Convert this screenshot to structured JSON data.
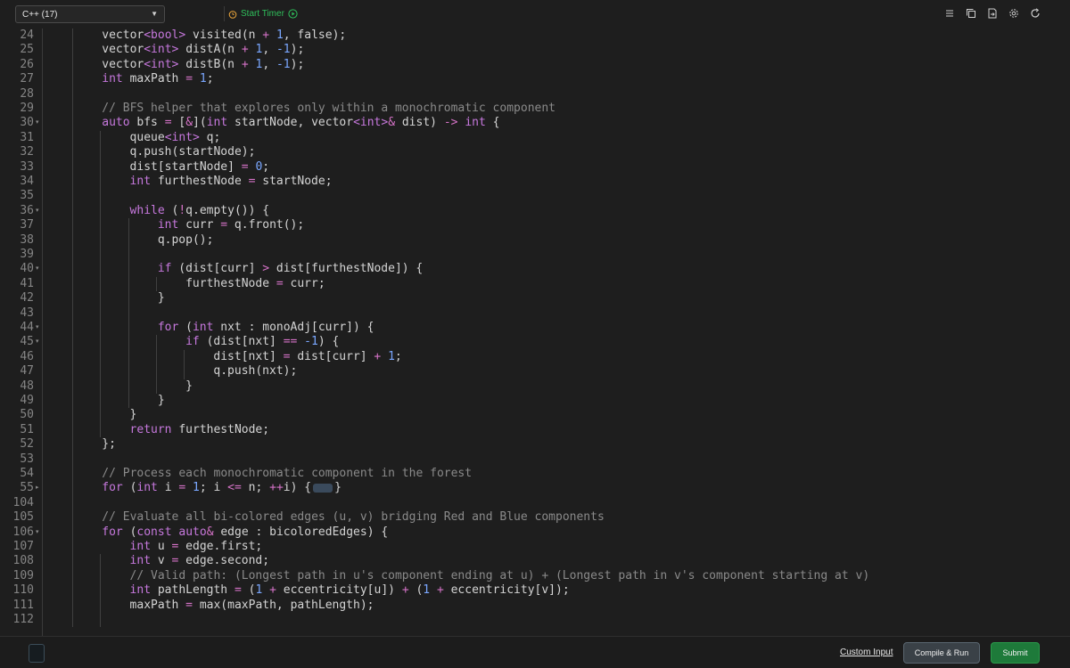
{
  "toolbar": {
    "language": "C++ (17)",
    "timer_label": "Start Timer"
  },
  "editor": {
    "lines": [
      {
        "n": "24",
        "fold": false,
        "indent": 1,
        "html": "vector<span class='ty'>&lt;bool&gt;</span> visited(n <span class='op'>+</span> <span class='num'>1</span>, false);"
      },
      {
        "n": "25",
        "fold": false,
        "indent": 1,
        "html": "vector<span class='ty'>&lt;int&gt;</span> distA(n <span class='op'>+</span> <span class='num'>1</span>, <span class='num'>-1</span>);"
      },
      {
        "n": "26",
        "fold": false,
        "indent": 1,
        "html": "vector<span class='ty'>&lt;int&gt;</span> distB(n <span class='op'>+</span> <span class='num'>1</span>, <span class='num'>-1</span>);"
      },
      {
        "n": "27",
        "fold": false,
        "indent": 1,
        "html": "<span class='kw'>int</span> maxPath <span class='op'>=</span> <span class='num'>1</span>;"
      },
      {
        "n": "28",
        "fold": false,
        "indent": 1,
        "html": ""
      },
      {
        "n": "29",
        "fold": false,
        "indent": 1,
        "html": "<span class='cm'>// BFS helper that explores only within a monochromatic component</span>"
      },
      {
        "n": "30",
        "fold": true,
        "indent": 1,
        "html": "<span class='kw'>auto</span> bfs <span class='op'>=</span> [<span class='op'>&amp;</span>](<span class='kw'>int</span> startNode, vector<span class='ty'>&lt;int&gt;</span><span class='op'>&amp;</span> dist) <span class='op'>-&gt;</span> <span class='kw'>int</span> {"
      },
      {
        "n": "31",
        "fold": false,
        "indent": 2,
        "html": "queue<span class='ty'>&lt;int&gt;</span> q;"
      },
      {
        "n": "32",
        "fold": false,
        "indent": 2,
        "html": "q.push(startNode);"
      },
      {
        "n": "33",
        "fold": false,
        "indent": 2,
        "html": "dist[startNode] <span class='op'>=</span> <span class='num'>0</span>;"
      },
      {
        "n": "34",
        "fold": false,
        "indent": 2,
        "html": "<span class='kw'>int</span> furthestNode <span class='op'>=</span> startNode;"
      },
      {
        "n": "35",
        "fold": false,
        "indent": 2,
        "html": ""
      },
      {
        "n": "36",
        "fold": true,
        "indent": 2,
        "html": "<span class='kw'>while</span> (<span class='op'>!</span>q.empty()) {"
      },
      {
        "n": "37",
        "fold": false,
        "indent": 3,
        "html": "<span class='kw'>int</span> curr <span class='op'>=</span> q.front();"
      },
      {
        "n": "38",
        "fold": false,
        "indent": 3,
        "html": "q.pop();"
      },
      {
        "n": "39",
        "fold": false,
        "indent": 3,
        "html": ""
      },
      {
        "n": "40",
        "fold": true,
        "indent": 3,
        "html": "<span class='kw'>if</span> (dist[curr] <span class='op'>&gt;</span> dist[furthestNode]) {"
      },
      {
        "n": "41",
        "fold": false,
        "indent": 4,
        "html": "furthestNode <span class='op'>=</span> curr;"
      },
      {
        "n": "42",
        "fold": false,
        "indent": 3,
        "html": "}"
      },
      {
        "n": "43",
        "fold": false,
        "indent": 3,
        "html": ""
      },
      {
        "n": "44",
        "fold": true,
        "indent": 3,
        "html": "<span class='kw'>for</span> (<span class='kw'>int</span> nxt : monoAdj[curr]) {"
      },
      {
        "n": "45",
        "fold": true,
        "indent": 4,
        "html": "<span class='kw'>if</span> (dist[nxt] <span class='op'>==</span> <span class='num'>-1</span>) {"
      },
      {
        "n": "46",
        "fold": false,
        "indent": 5,
        "html": "dist[nxt] <span class='op'>=</span> dist[curr] <span class='op'>+</span> <span class='num'>1</span>;"
      },
      {
        "n": "47",
        "fold": false,
        "indent": 5,
        "html": "q.push(nxt);"
      },
      {
        "n": "48",
        "fold": false,
        "indent": 4,
        "html": "}"
      },
      {
        "n": "49",
        "fold": false,
        "indent": 3,
        "html": "}"
      },
      {
        "n": "50",
        "fold": false,
        "indent": 2,
        "html": "}"
      },
      {
        "n": "51",
        "fold": false,
        "indent": 2,
        "html": "<span class='kw'>return</span> furthestNode;"
      },
      {
        "n": "52",
        "fold": false,
        "indent": 1,
        "html": "};"
      },
      {
        "n": "53",
        "fold": false,
        "indent": 1,
        "html": ""
      },
      {
        "n": "54",
        "fold": false,
        "indent": 1,
        "html": "<span class='cm'>// Process each monochromatic component in the forest</span>"
      },
      {
        "n": "55",
        "fold": "collapsed",
        "indent": 1,
        "html": "<span class='kw'>for</span> (<span class='kw'>int</span> i <span class='op'>=</span> <span class='num'>1</span>; i <span class='op'>&lt;=</span> n; <span class='op'>++</span>i) {<span class='fold-chip'></span>}"
      },
      {
        "n": "104",
        "fold": false,
        "indent": 1,
        "html": ""
      },
      {
        "n": "105",
        "fold": false,
        "indent": 1,
        "html": "<span class='cm'>// Evaluate all bi-colored edges (u, v) bridging Red and Blue components</span>"
      },
      {
        "n": "106",
        "fold": true,
        "indent": 1,
        "html": "<span class='kw'>for</span> (<span class='kw'>const</span> <span class='kw'>auto</span><span class='op'>&amp;</span> edge : bicoloredEdges) {"
      },
      {
        "n": "107",
        "fold": false,
        "indent": 2,
        "html": "<span class='kw'>int</span> u <span class='op'>=</span> edge.first;"
      },
      {
        "n": "108",
        "fold": false,
        "indent": 2,
        "html": "<span class='kw'>int</span> v <span class='op'>=</span> edge.second;"
      },
      {
        "n": "109",
        "fold": false,
        "indent": 2,
        "html": "<span class='cm'>// Valid path: (Longest path in u's component ending at u) + (Longest path in v's component starting at v)</span>"
      },
      {
        "n": "110",
        "fold": false,
        "indent": 2,
        "html": "<span class='kw'>int</span> pathLength <span class='op'>=</span> (<span class='num'>1</span> <span class='op'>+</span> eccentricity[u]) <span class='op'>+</span> (<span class='num'>1</span> <span class='op'>+</span> eccentricity[v]);"
      },
      {
        "n": "111",
        "fold": false,
        "indent": 2,
        "html": "maxPath <span class='op'>=</span> max(maxPath, pathLength);"
      },
      {
        "n": "112",
        "fold": false,
        "indent": 1,
        "html": ""
      }
    ]
  },
  "bottom": {
    "custom_input": "Custom Input",
    "compile_run": "Compile & Run",
    "submit": "Submit"
  }
}
